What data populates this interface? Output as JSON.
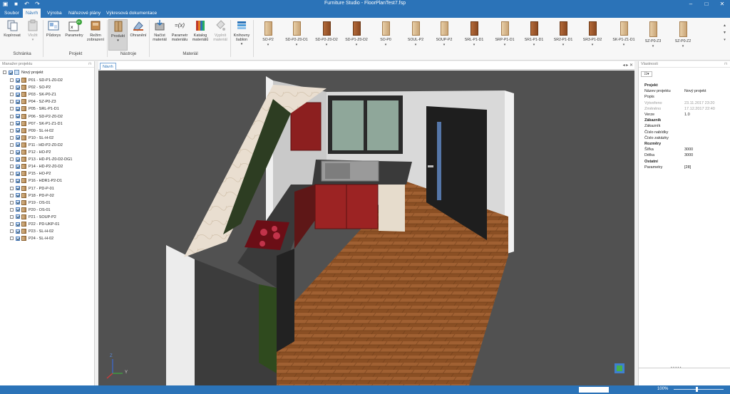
{
  "app": {
    "title": "Furniture Studio - FloorPlanTest7.fsp"
  },
  "tabs": [
    "Soubor",
    "Návrh",
    "Výroba",
    "Nářezové plány",
    "Výkresová dokumentace"
  ],
  "ribbon": {
    "buttons": [
      {
        "label": "Kopírovat"
      },
      {
        "label": "Vložit"
      },
      {
        "label": "Půdorys"
      },
      {
        "label": "Parametry",
        "badge": "29"
      },
      {
        "label": "Režim zobrazení"
      },
      {
        "label": "Produkt"
      },
      {
        "label": "Ohranění"
      },
      {
        "label": "Načíst materiál"
      },
      {
        "label": "Parametr materiálu",
        "glyph": "=(x)"
      },
      {
        "label": "Katalog materiálů"
      },
      {
        "label": "Vyplnit materiál"
      },
      {
        "label": "Knihovny šablon"
      }
    ],
    "groups": [
      "Schránka",
      "Projekt",
      "Nástroje",
      "Materiál"
    ],
    "cabinets": [
      "SO-P2",
      "SD-P2-Z0-D1",
      "SD-P2-Z0-D2",
      "SD-P1-Z0-D2",
      "SO-P0",
      "SOUL-P2",
      "SOUP-P2",
      "SRL-P1-D1",
      "SRP-P1-D1",
      "SR1-P1-D1",
      "SR2-P1-D1",
      "SR3-P1-D2",
      "SK-P1-Z1-D1",
      "SZ-P0-Z3",
      "SZ-P0-Z2"
    ]
  },
  "left_panel": {
    "title": "Manažer projektu",
    "root": "Nový projekt",
    "items": [
      "P01 - SD-P1-Z0-D2",
      "P02 - SO-P2",
      "P03 - SK-P0-Z1",
      "P04 - SZ-P0-Z3",
      "P05 - SRL-P1-D1",
      "P06 - SD-P2-Z0-D2",
      "P07 - SK-P1-Z1-D1",
      "P09 - SL-H-02",
      "P10 - SL-H-02",
      "P11 - HD-P2-Z0-D2",
      "P12 - HO-P2",
      "P13 - HD-P1-Z0-D2-DG1",
      "P14 - HD-P2-Z0-D2",
      "P15 - HO-P2",
      "P16 - HDR1-P2-D1",
      "P17 - PD-P-01",
      "P18 - PD-P-02",
      "P19 - OS-01",
      "P20 - OS-01",
      "P21 - SOUP-P2",
      "P22 - PD-UKP-01",
      "P23 - SL-H-02",
      "P24 - SL-H-02"
    ]
  },
  "doc_tab": "Návrh",
  "right_panel": {
    "title": "Vlastnosti",
    "rows": [
      {
        "k": "Projekt",
        "v": "",
        "cat": true
      },
      {
        "k": "Název projektu",
        "v": "Nový projekt"
      },
      {
        "k": "Popis",
        "v": ""
      },
      {
        "k": "Vytvořeno",
        "v": "23.11.2017 23:20",
        "dim": true
      },
      {
        "k": "Změněno",
        "v": "17.12.2017 22:40",
        "dim": true
      },
      {
        "k": "Verze",
        "v": "1.0"
      },
      {
        "k": "Zákazník",
        "v": "",
        "cat": true
      },
      {
        "k": "Zákazník",
        "v": ""
      },
      {
        "k": "Číslo nabídky",
        "v": ""
      },
      {
        "k": "Číslo zakázky",
        "v": ""
      },
      {
        "k": "Rozměry",
        "v": "",
        "cat": true
      },
      {
        "k": "Šířka",
        "v": "3000"
      },
      {
        "k": "Délka",
        "v": "3000"
      },
      {
        "k": "Ostatní",
        "v": "",
        "cat": true
      },
      {
        "k": "Parametry",
        "v": "[28]"
      }
    ]
  },
  "axes": {
    "z": "Z",
    "y": "Y"
  },
  "status": {
    "zoom": "100%"
  }
}
